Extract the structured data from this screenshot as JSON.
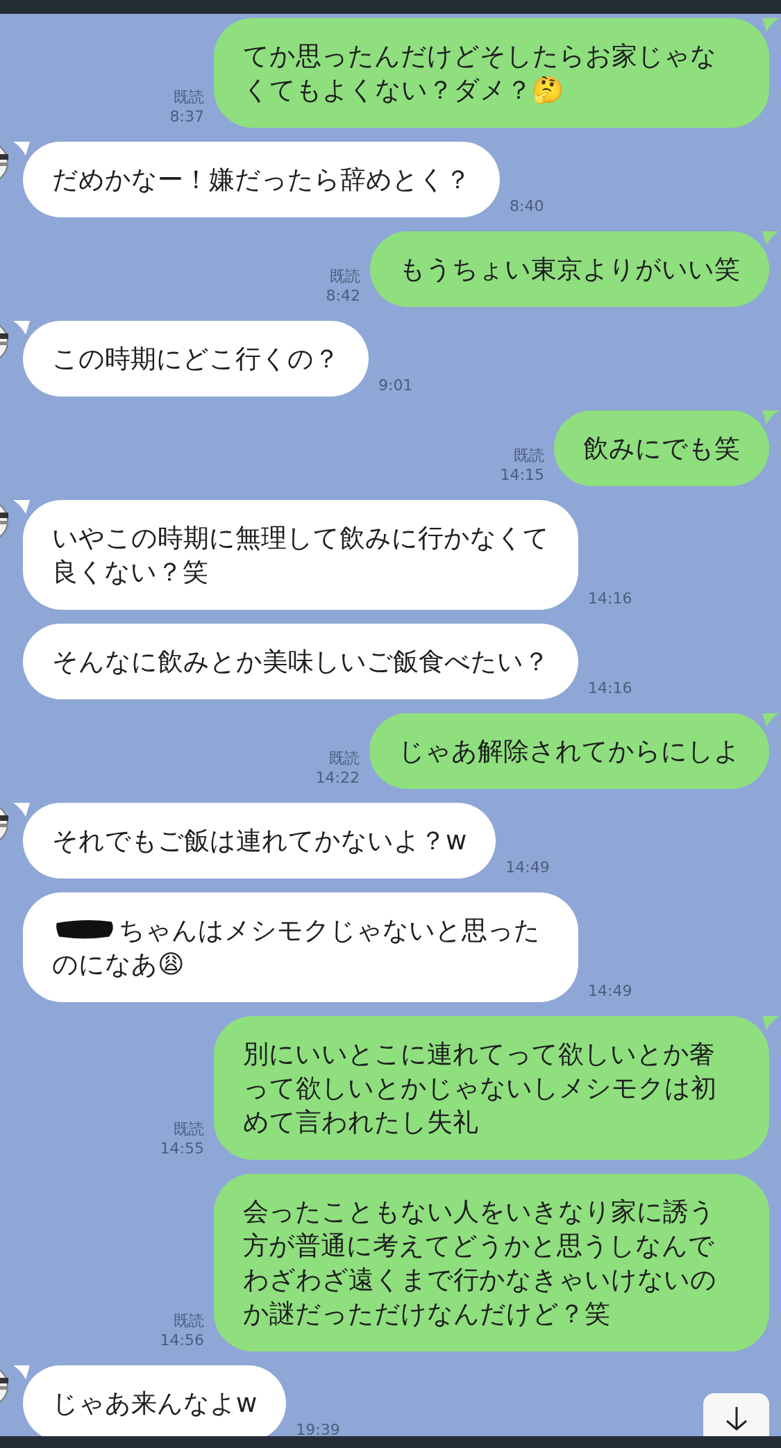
{
  "messages": [
    {
      "kind": "sent",
      "text": "てか思ったんだけどそしたらお家じゃなくてもよくない？ダメ？🤔",
      "read": "既読",
      "time": "8:37"
    },
    {
      "kind": "received",
      "text": "だめかなー！嫌だったら辞めとく？",
      "time": "8:40"
    },
    {
      "kind": "sent",
      "text": "もうちょい東京よりがいい笑",
      "read": "既読",
      "time": "8:42"
    },
    {
      "kind": "received",
      "text": "この時期にどこ行くの？",
      "time": "9:01"
    },
    {
      "kind": "sent",
      "text": "飲みにでも笑",
      "read": "既読",
      "time": "14:15"
    },
    {
      "kind": "received",
      "text": "いやこの時期に無理して飲みに行かなくて良くない？笑",
      "time": "14:16"
    },
    {
      "kind": "received",
      "text": "そんなに飲みとか美味しいご飯食べたい？",
      "time": "14:16"
    },
    {
      "kind": "sent",
      "text": "じゃあ解除されてからにしよ",
      "read": "既読",
      "time": "14:22"
    },
    {
      "kind": "received",
      "text": "それでもご飯は連れてかないよ？w",
      "time": "14:49"
    },
    {
      "kind": "received",
      "redacted": true,
      "text": "ちゃんはメシモクじゃないと思ったのになあ😩",
      "time": "14:49"
    },
    {
      "kind": "sent",
      "text": "別にいいとこに連れてって欲しいとか奢って欲しいとかじゃないしメシモクは初めて言われたし失礼",
      "read": "既読",
      "time": "14:55"
    },
    {
      "kind": "sent",
      "text": "会ったこともない人をいきなり家に誘う方が普通に考えてどうかと思うしなんでわざわざ遠くまで行かなきゃいけないのか謎だっただけなんだけど？笑",
      "read": "既読",
      "time": "14:56"
    },
    {
      "kind": "received",
      "text": "じゃあ来んなよw",
      "time": "19:39"
    }
  ]
}
